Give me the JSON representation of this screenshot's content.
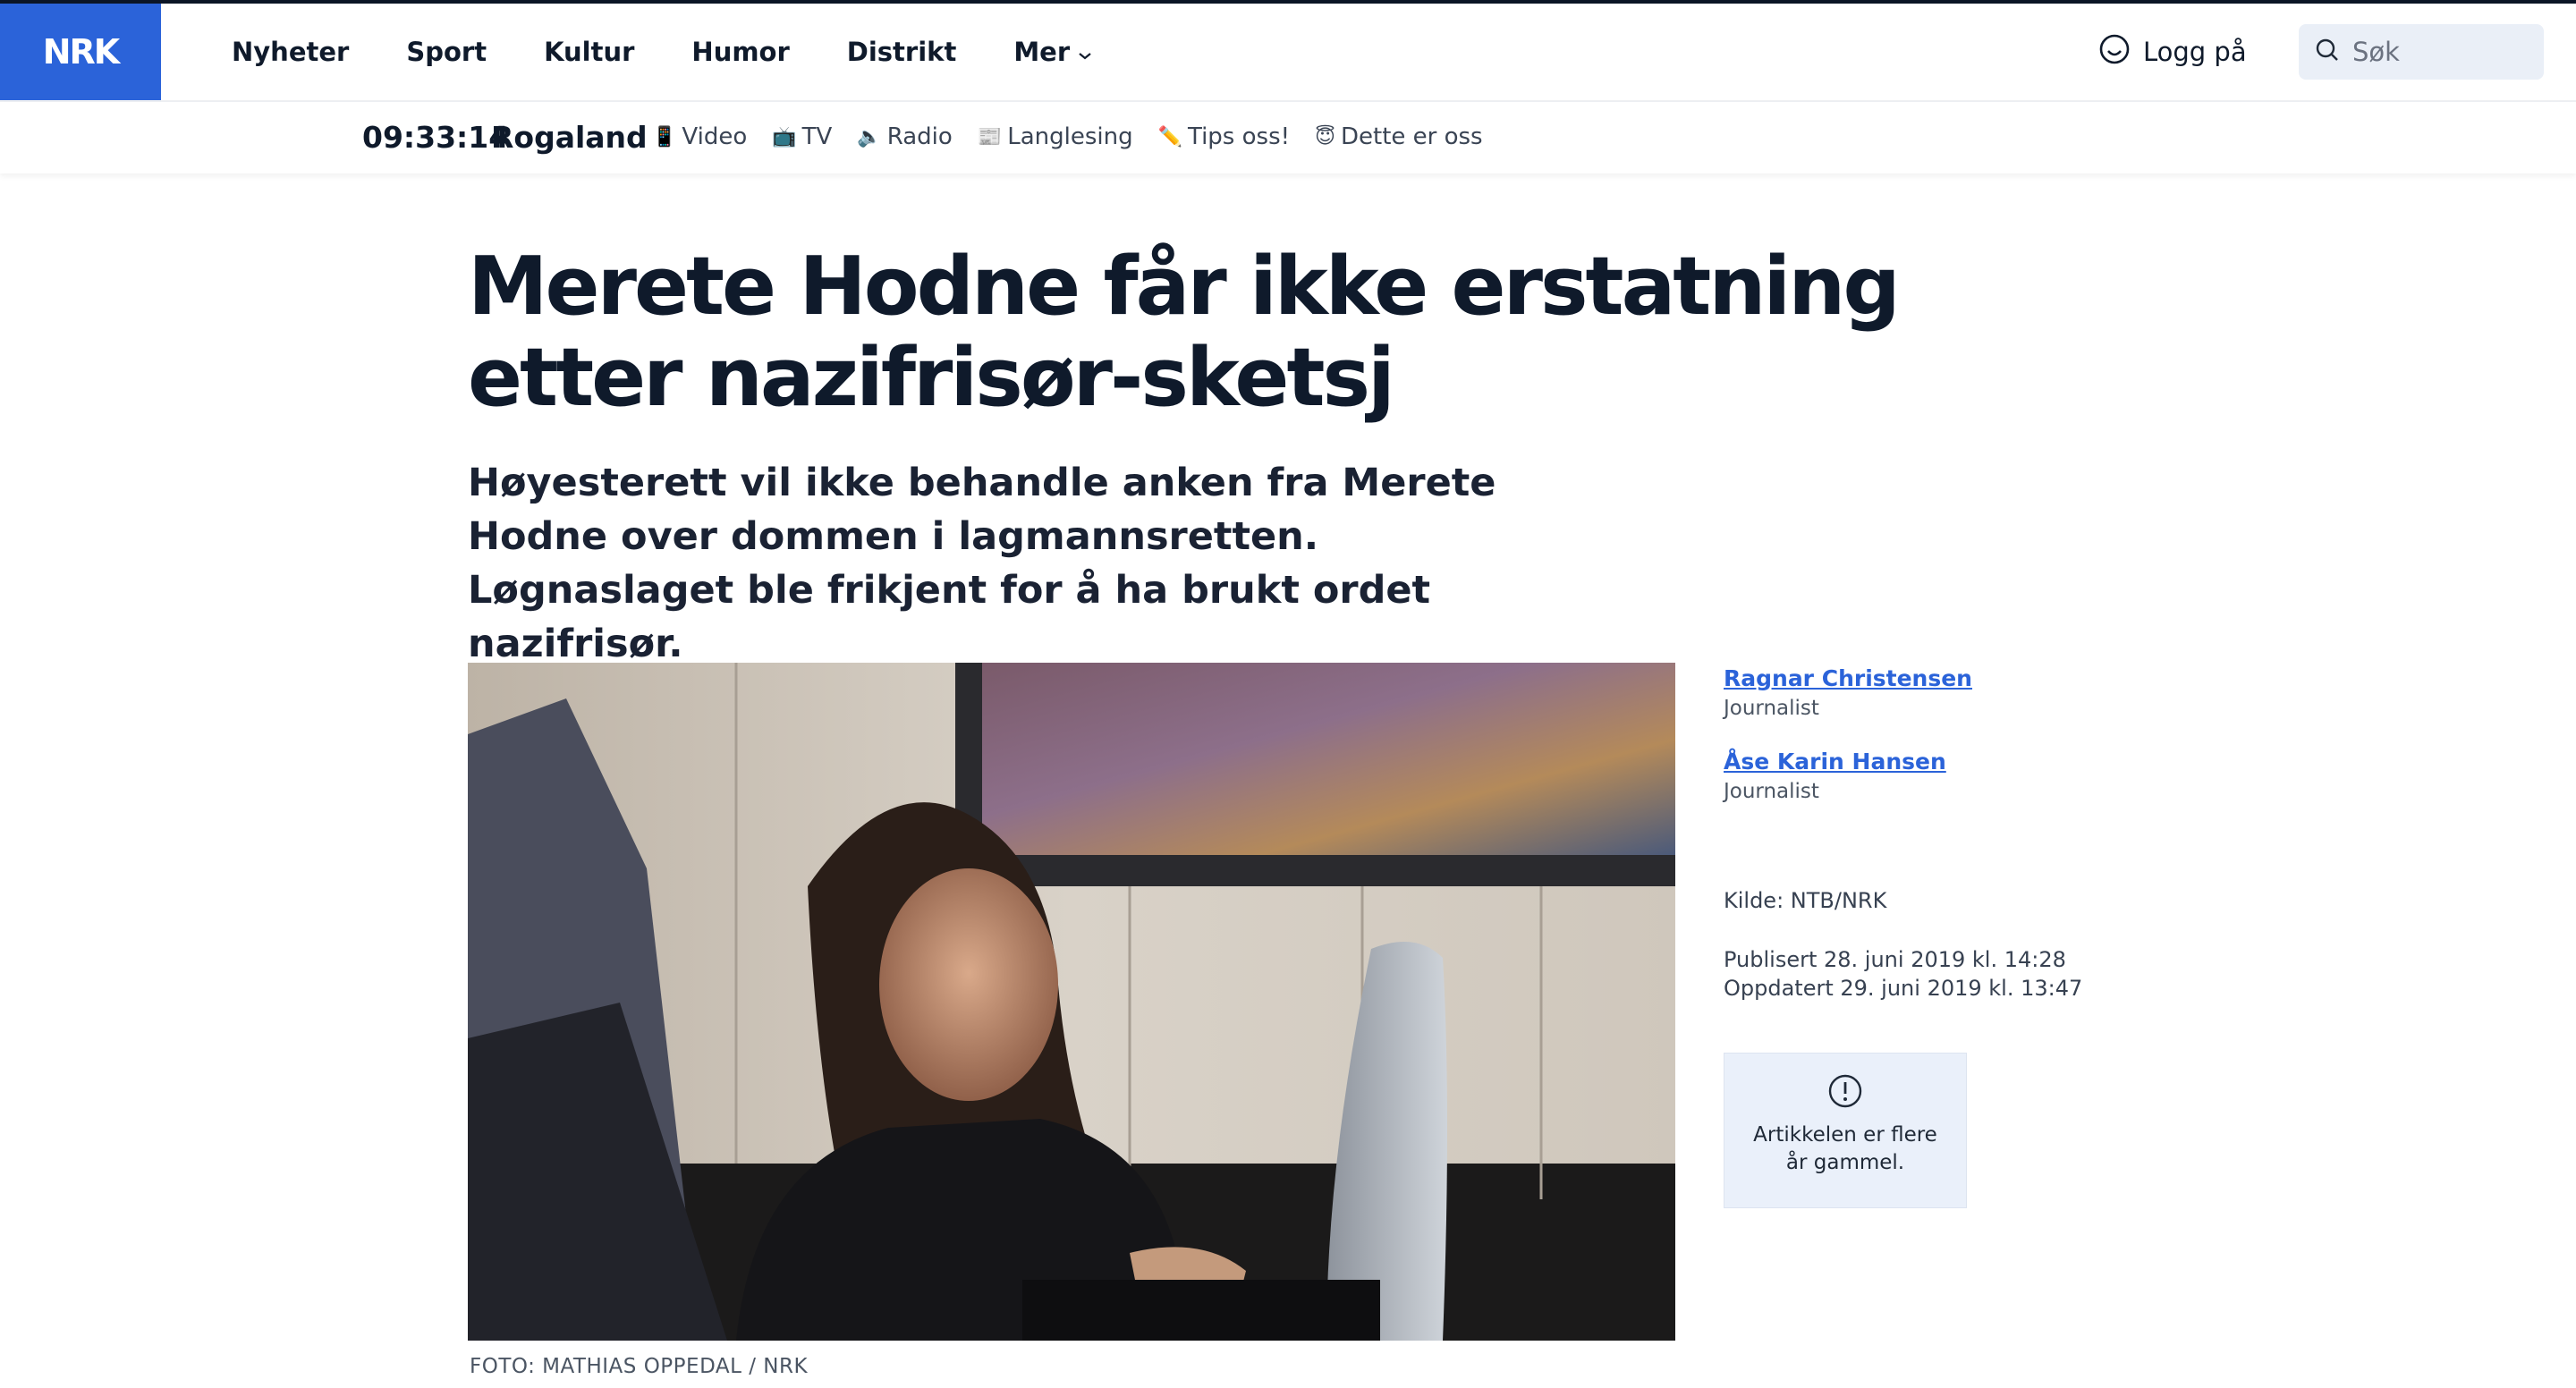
{
  "header": {
    "logo_text": "NRK",
    "nav": [
      "Nyheter",
      "Sport",
      "Kultur",
      "Humor",
      "Distrikt",
      "Mer"
    ],
    "login_label": "Logg på",
    "search_placeholder": "Søk"
  },
  "subheader": {
    "clock": "09:33:14",
    "region": "Rogaland",
    "links": [
      {
        "icon": "📱",
        "label": "Video"
      },
      {
        "icon": "📺",
        "label": "TV"
      },
      {
        "icon": "🔈",
        "label": "Radio"
      },
      {
        "icon": "📰",
        "label": "Langlesing"
      },
      {
        "icon": "✏️",
        "label": "Tips oss!"
      },
      {
        "icon": "😇",
        "label": "Dette er oss"
      }
    ]
  },
  "article": {
    "title": "Merete Hodne får ikke erstatning etter nazifrisør-sketsj",
    "lead": "Høyesterett vil ikke behandle anken fra Merete Hodne over dommen i lagmannsretten. Løgnaslaget ble frikjent for å ha brukt ordet nazifrisør.",
    "photo_caption": "FOTO: MATHIAS OPPEDAL / NRK"
  },
  "sidebar": {
    "authors": [
      {
        "name": "Ragnar Christensen",
        "role": "Journalist"
      },
      {
        "name": "Åse Karin Hansen",
        "role": "Journalist"
      }
    ],
    "source": "Kilde: NTB/NRK",
    "published": "Publisert 28. juni 2019 kl. 14:28",
    "updated": "Oppdatert 29. juni 2019 kl. 13:47",
    "notice": "Artikkelen er flere år gammel."
  },
  "colors": {
    "brand": "#2b63d9",
    "text": "#0f1a2b",
    "notice_bg": "#eaf0fa"
  }
}
